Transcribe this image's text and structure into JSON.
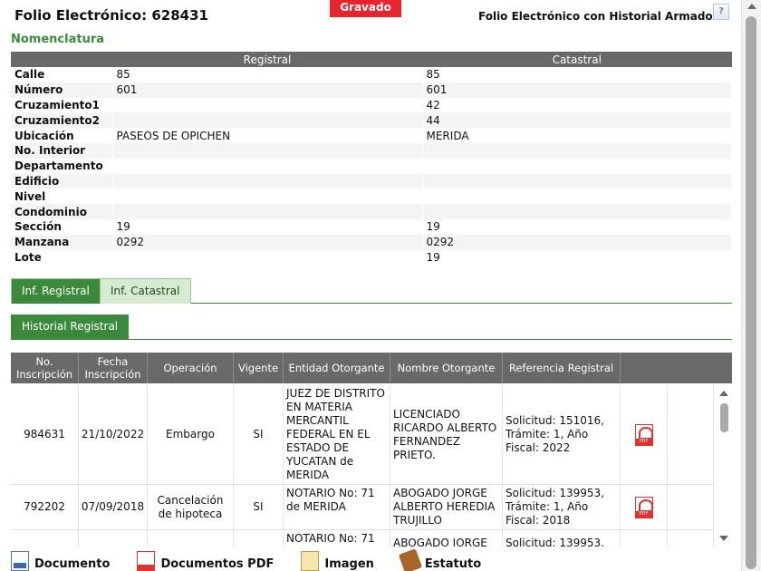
{
  "header": {
    "folio_title": "Folio Electrónico: 628431",
    "status": "Gravado",
    "history_note": "Folio Electrónico con Historial Armado",
    "help_label": "?"
  },
  "nomenclatura": {
    "title": "Nomenclatura",
    "headers": {
      "registral": "Registral",
      "catastral": "Catastral"
    },
    "rows": [
      {
        "label": "Calle",
        "registral": "85",
        "catastral": "85"
      },
      {
        "label": "Número",
        "registral": "601",
        "catastral": "601"
      },
      {
        "label": "Cruzamiento1",
        "registral": "",
        "catastral": "42"
      },
      {
        "label": "Cruzamiento2",
        "registral": "",
        "catastral": "44"
      },
      {
        "label": "Ubicación",
        "registral": "PASEOS DE OPICHEN",
        "catastral": "MERIDA"
      },
      {
        "label": "No. Interior",
        "registral": "",
        "catastral": ""
      },
      {
        "label": "Departamento",
        "registral": "",
        "catastral": ""
      },
      {
        "label": "Edificio",
        "registral": "",
        "catastral": ""
      },
      {
        "label": "Nivel",
        "registral": "",
        "catastral": ""
      },
      {
        "label": "Condominio",
        "registral": "",
        "catastral": ""
      },
      {
        "label": "Sección",
        "registral": "19",
        "catastral": "19"
      },
      {
        "label": "Manzana",
        "registral": "0292",
        "catastral": "0292"
      },
      {
        "label": "Lote",
        "registral": "",
        "catastral": "19"
      }
    ]
  },
  "tabs": {
    "inf_registral": "Inf. Registral",
    "inf_catastral": "Inf. Catastral",
    "historial_registral": "Historial Registral"
  },
  "historial": {
    "columns": [
      "No. Inscripción",
      "Fecha Inscripción",
      "Operación",
      "Vigente",
      "Entidad Otorgante",
      "Nombre Otorgante",
      "Referencia Registral"
    ],
    "rows": [
      {
        "no": "984631",
        "fecha": "21/10/2022",
        "operacion": "Embargo",
        "vigente": "SI",
        "entidad": "JUEZ DE DISTRITO EN MATERIA MERCANTIL FEDERAL EN EL ESTADO DE YUCATAN de MERIDA",
        "nombre": "LICENCIADO RICARDO ALBERTO FERNANDEZ PRIETO.",
        "referencia": "Solicitud: 151016, Trámite: 1, Año Fiscal: 2022"
      },
      {
        "no": "792202",
        "fecha": "07/09/2018",
        "operacion": "Cancelación de hipoteca",
        "vigente": "SI",
        "entidad": "NOTARIO No: 71 de MERIDA",
        "nombre": "ABOGADO JORGE ALBERTO HEREDIA TRUJILLO",
        "referencia": "Solicitud: 139953, Trámite: 1, Año Fiscal: 2018"
      },
      {
        "no": "",
        "fecha": "",
        "operacion": "",
        "vigente": "",
        "entidad": "NOTARIO No: 71",
        "nombre": "ABOGADO JORGE",
        "referencia": "Solicitud: 139953,"
      }
    ]
  },
  "toolbar": {
    "documento": "Documento",
    "documentos_pdf": "Documentos PDF",
    "imagen": "Imagen",
    "estatuto": "Estatuto"
  },
  "colors": {
    "accent_green": "#3b8a3b",
    "badge_red": "#e8232e",
    "header_gray": "#696969"
  }
}
